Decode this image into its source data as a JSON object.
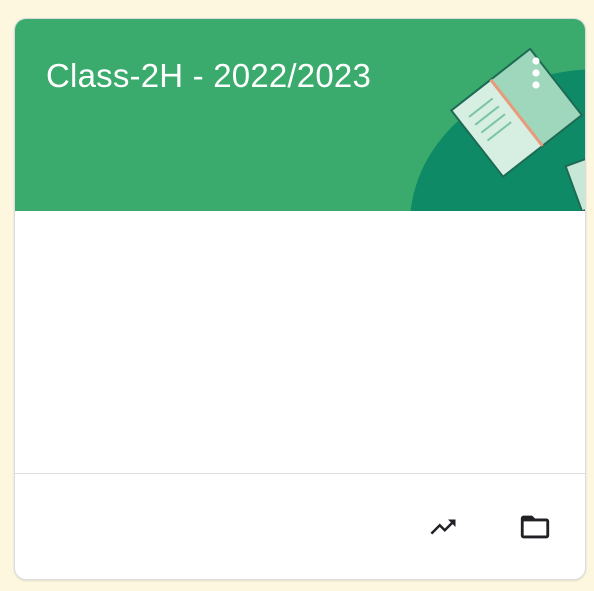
{
  "card": {
    "title": "Class-2H - 2022/2023"
  },
  "colors": {
    "header_bg": "#3aab6c",
    "header_shape": "#0f8a67",
    "page_bg": "#fef7e0",
    "icon": "#202124"
  },
  "icons": {
    "more": "more-vert-icon",
    "progress": "trending-up-icon",
    "folder": "folder-icon"
  }
}
